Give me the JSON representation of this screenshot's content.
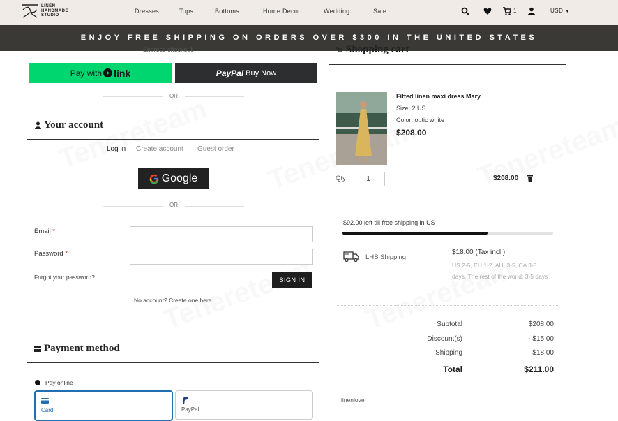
{
  "header": {
    "logo_lines": [
      "LINEN",
      "HANDMADE",
      "STUDIO"
    ],
    "nav": [
      "Dresses",
      "Tops",
      "Bottoms",
      "Home Decor",
      "Wedding",
      "Sale"
    ],
    "cart_count": "1",
    "currency": "USD"
  },
  "banner": {
    "text": "ENJOY FREE SHIPPING ON ORDERS OVER $300 IN THE UNITED STATES"
  },
  "checkout": {
    "express_label": "Express checkout",
    "link_button": {
      "pay_with": "Pay with",
      "brand": "link"
    },
    "paypal_button": {
      "brand": "PayPal",
      "label": "Buy Now"
    },
    "or_label": "OR"
  },
  "account": {
    "title": "Your account",
    "tabs": [
      "Log in",
      "Create account",
      "Guest order"
    ],
    "google_label": "Google",
    "or_label": "OR",
    "email_label": "Email",
    "password_label": "Password",
    "required_mark": "*",
    "forgot": "Forgot your password?",
    "signin": "SIGN IN",
    "no_account": "No account? Create one here"
  },
  "payment": {
    "title": "Payment method",
    "pay_online": "Pay online",
    "options": [
      "Card",
      "PayPal"
    ]
  },
  "cart": {
    "title": "Shopping cart",
    "item": {
      "name": "Fitted linen maxi dress Mary",
      "size": "Size: 2 US",
      "color": "Color: optic white",
      "price": "$208.00",
      "qty_label": "Qty",
      "qty": "1",
      "line_total": "$208.00"
    },
    "free_shipping_note": "$92.00 left till free shipping in US",
    "free_shipping_progress": 0.69,
    "shipping": {
      "method": "LHS Shipping",
      "price": "$18.00 (Tax incl.)",
      "desc": "US 2-5, EU 1-2, AU, 3-5, CA 3-5 days. The rest of the world: 3-5 days"
    },
    "summary": [
      {
        "label": "Subtotal",
        "value": "$208.00"
      },
      {
        "label": "Discount(s)",
        "value": "- $15.00"
      },
      {
        "label": "Shipping",
        "value": "$18.00"
      },
      {
        "label": "Total",
        "value": "$211.00"
      }
    ],
    "promo_code": "linenlove"
  },
  "watermark": "Tenereteam"
}
